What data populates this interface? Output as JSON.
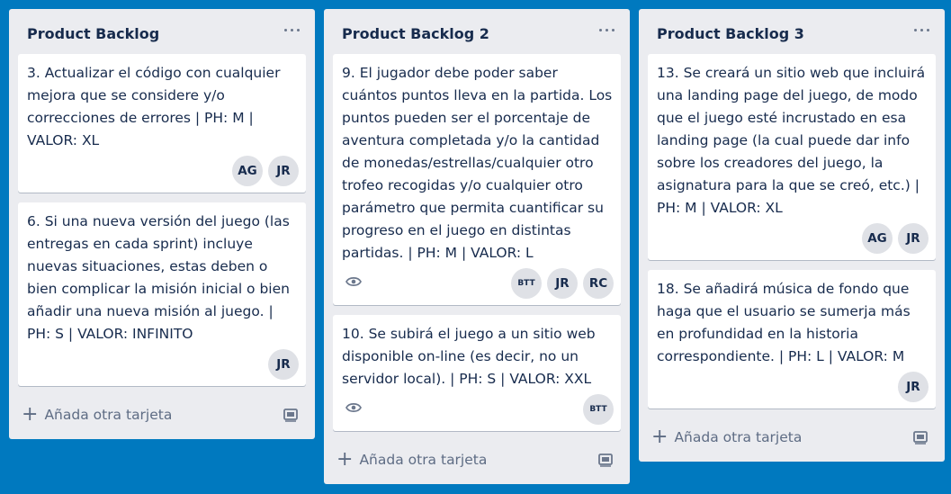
{
  "lists": [
    {
      "title": "Product Backlog",
      "add_card_label": "Añada otra tarjeta",
      "cards": [
        {
          "text": "3. Actualizar el código con cualquier mejora que se considere y/o correcciones de errores | PH: M | VALOR: XL",
          "members": [
            "AG",
            "JR"
          ]
        },
        {
          "text": "6. Si una nueva versión del juego (las entregas en cada sprint) incluye nuevas situaciones, estas deben o bien complicar la misión inicial o bien añadir una nueva misión al juego. | PH: S | VALOR: INFINITO",
          "members": [
            "JR"
          ]
        }
      ]
    },
    {
      "title": "Product Backlog 2",
      "add_card_label": "Añada otra tarjeta",
      "cards": [
        {
          "text": "9. El jugador debe poder saber cuántos puntos lleva en la partida. Los puntos pueden ser el porcentaje de aventura completada y/o la cantidad de monedas/estrellas/cualquier otro trofeo recogidas y/o cualquier otro parámetro que permita cuantificar su progreso en el juego en distintas partidas. | PH: M | VALOR: L",
          "members": [
            "BTT",
            "JR",
            "RC"
          ],
          "badge_icon": "eye-icon"
        },
        {
          "text": "10. Se subirá el juego a un sitio web disponible on-line (es decir, no un servidor local). | PH: S | VALOR: XXL",
          "members": [
            "BTT"
          ],
          "badge_icon": "eye-icon"
        }
      ]
    },
    {
      "title": "Product Backlog 3",
      "add_card_label": "Añada otra tarjeta",
      "cards": [
        {
          "text": "13. Se creará un sitio web que incluirá una landing page del juego, de modo que el juego esté incrustado en esa landing page (la cual puede dar info sobre los creadores del juego, la asignatura para la que se creó, etc.) | PH: M | VALOR: XL",
          "members": [
            "AG",
            "JR"
          ]
        },
        {
          "text": "18. Se añadirá música de fondo que haga que el usuario se sumerja más en profundidad en la historia correspondiente. | PH: L | VALOR: M",
          "members": [
            "JR"
          ]
        }
      ]
    }
  ],
  "colors": {
    "board_background": "#0079bf",
    "list_background": "#ebecf0",
    "card_background": "#ffffff",
    "text": "#172b4d",
    "muted": "#5e6c84",
    "avatar": "#dfe1e6"
  }
}
